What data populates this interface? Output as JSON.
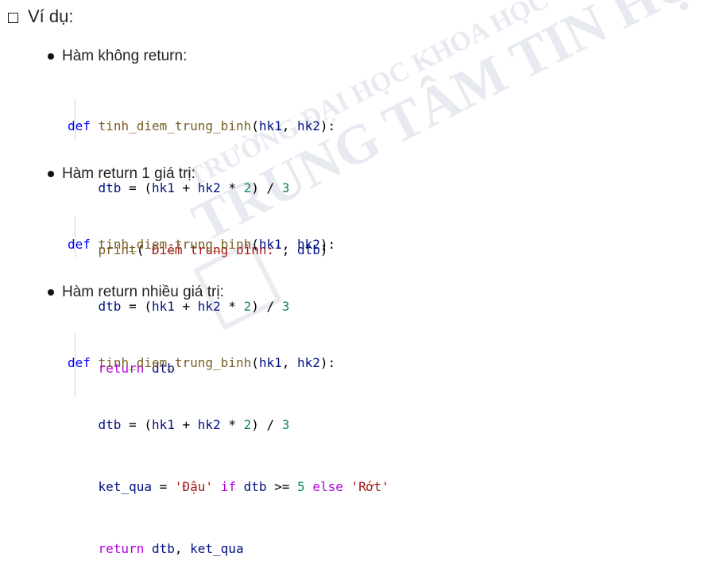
{
  "heading": "Ví dụ:",
  "bullets": [
    "Hàm không return:",
    "Hàm return 1 giá trị:",
    "Hàm return nhiều giá trị:"
  ],
  "code1": {
    "l1": "def tinh_diem_trung_binh(hk1, hk2):",
    "l2": "    dtb = (hk1 + hk2 * 2) / 3",
    "l3": "    print('Điểm trung bình:', dtb)"
  },
  "code2": {
    "l1": "def tinh_diem_trung_binh(hk1, hk2):",
    "l2": "    dtb = (hk1 + hk2 * 2) / 3",
    "l3": "    return dtb"
  },
  "code3": {
    "l1": "def tinh_diem_trung_binh(hk1, hk2):",
    "l2": "    dtb = (hk1 + hk2 * 2) / 3",
    "l3": "    ket_qua = 'Đậu' if dtb >= 5 else 'Rớt'",
    "l4": "    return dtb, ket_qua"
  },
  "watermark": {
    "line1": "TRƯỜNG ĐẠI HỌC KHOA HỌC TỰ NHIÊN",
    "line2": "TRUNG TÂM TIN HỌC"
  },
  "colors": {
    "keyword": "#0000ff",
    "control_keyword": "#af00db",
    "function": "#795e26",
    "variable": "#001080",
    "number": "#098658",
    "string": "#a31515"
  }
}
